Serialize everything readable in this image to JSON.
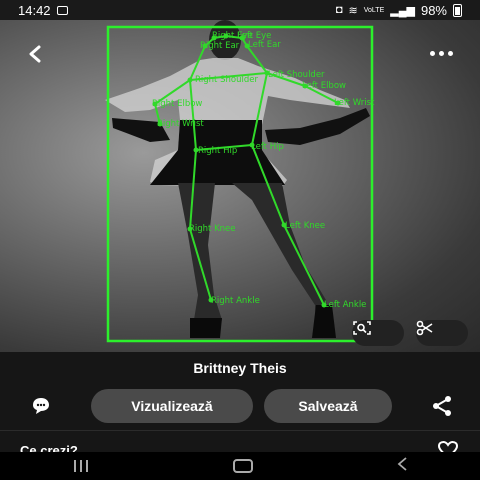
{
  "status_bar": {
    "time": "14:42",
    "network": "VoLTE",
    "battery": "98%"
  },
  "pose": {
    "keypoints": [
      "Right Eye",
      "Left Eye",
      "Right Ear",
      "Left Ear",
      "Right Shoulder",
      "Left Shoulder",
      "Right Elbow",
      "Left Elbow",
      "Right Wrist",
      "Left Wrist",
      "Right Hip",
      "Left Hip",
      "Right Knee",
      "Left Knee",
      "Right Ankle",
      "Left Ankle"
    ],
    "box_color": "#2cf02c",
    "skeleton_color": "#31d92a"
  },
  "detail": {
    "title": "Brittney Theis",
    "view_button": "Vizualizează",
    "save_button": "Salvează",
    "question": "Ce crezi?"
  },
  "icons": {
    "back": "chevron-left-icon",
    "more": "more-horizontal-icon",
    "lens": "lens-scan-icon",
    "crop": "scissors-icon",
    "comment": "comment-icon",
    "share": "share-icon",
    "heart": "heart-icon"
  }
}
